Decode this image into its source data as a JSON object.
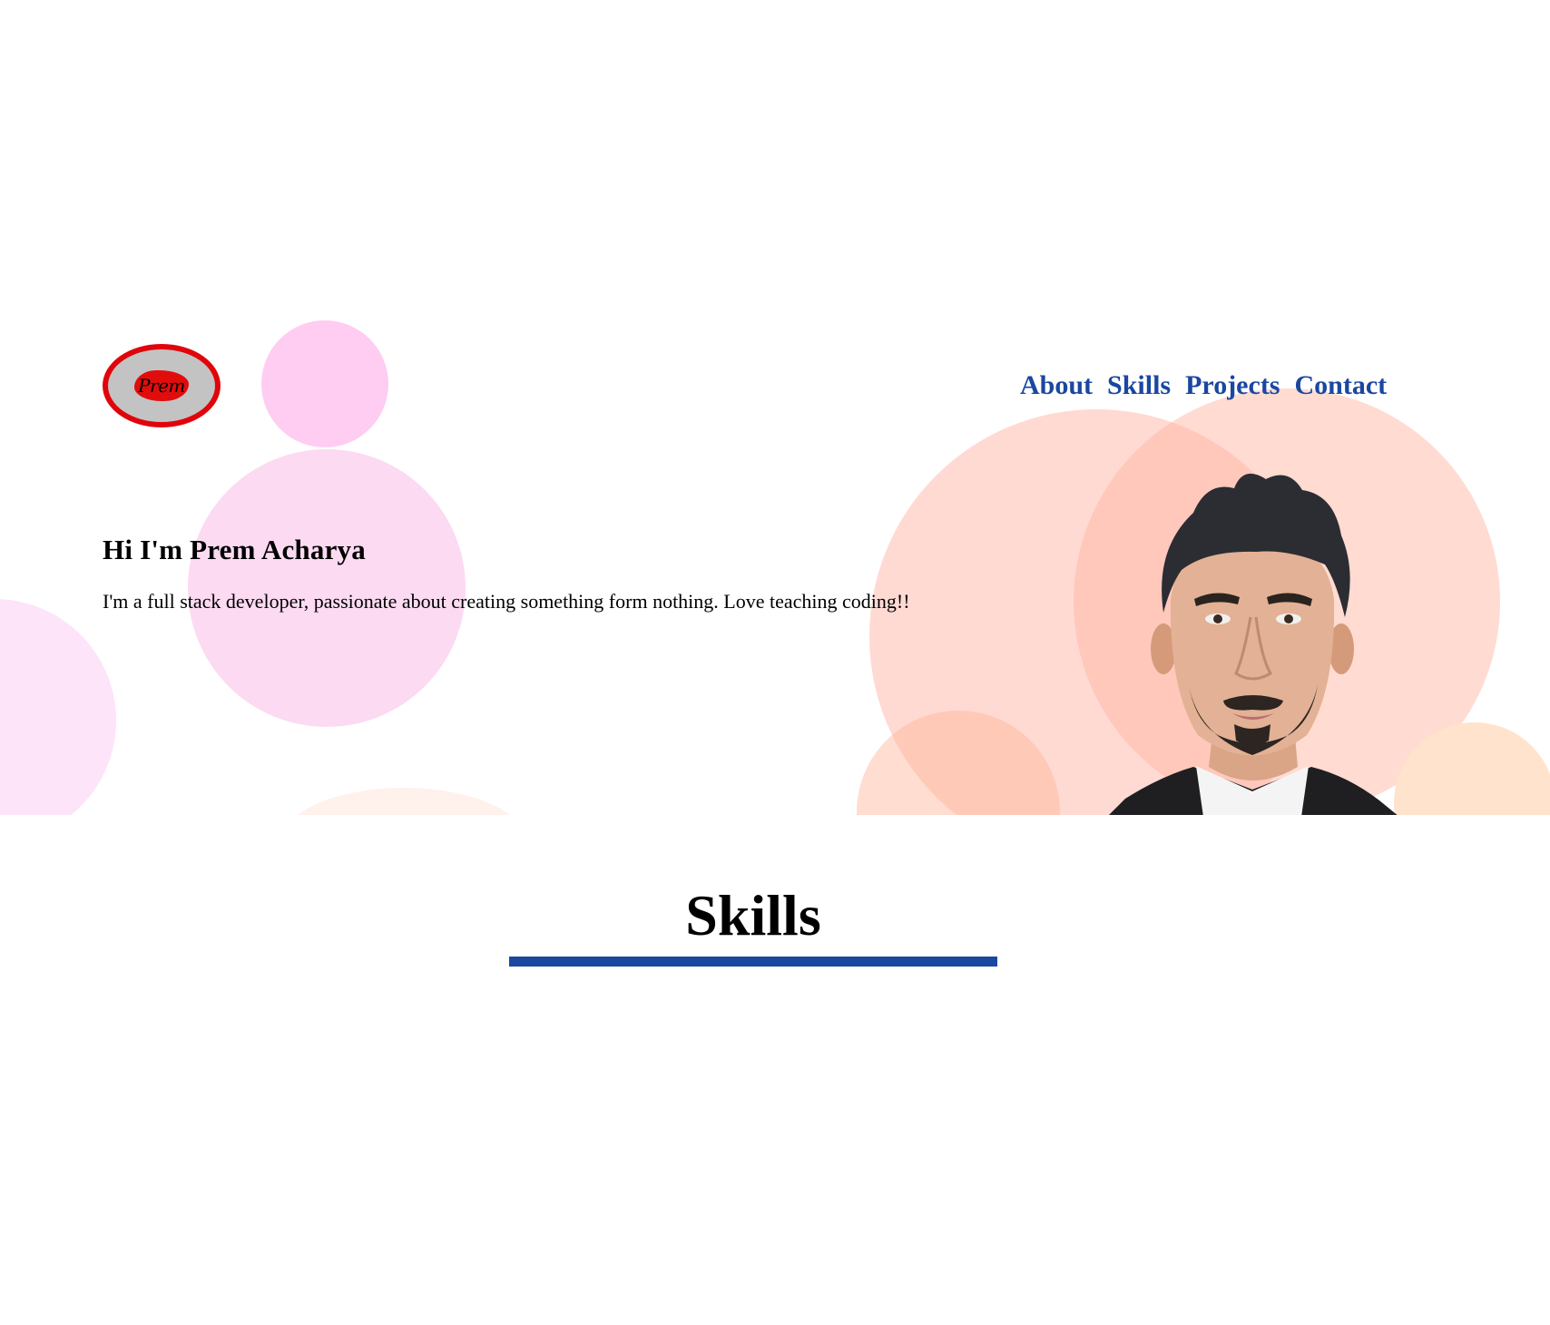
{
  "logo": {
    "text": "Prem"
  },
  "nav": {
    "items": [
      {
        "label": "About"
      },
      {
        "label": "Skills"
      },
      {
        "label": "Projects"
      },
      {
        "label": "Contact"
      }
    ]
  },
  "intro": {
    "title": "Hi I'm Prem Acharya",
    "description": "I'm a full stack developer, passionate about creating something form nothing. Love teaching coding!!"
  },
  "skills": {
    "title": "Skills"
  },
  "colors": {
    "nav_link": "#1a47a0",
    "underline": "#1a47a0",
    "logo_ring": "#e0050b",
    "logo_fill": "#c3c3c3"
  }
}
